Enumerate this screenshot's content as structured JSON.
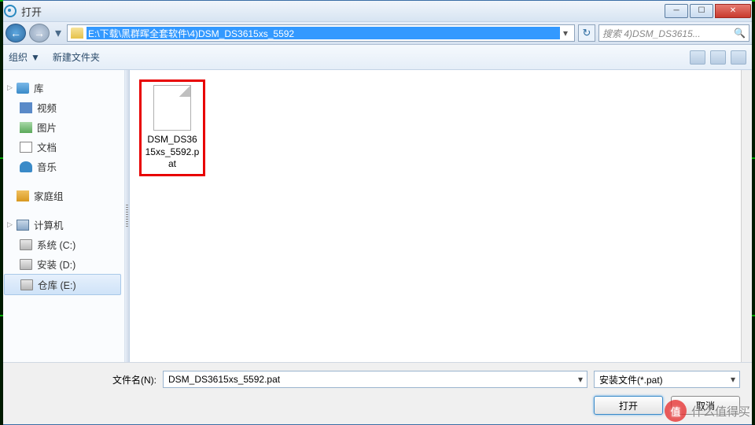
{
  "title": "打开",
  "address_path": "E:\\下载\\黑群晖全套软件\\4)DSM_DS3615xs_5592",
  "search_placeholder": "搜索 4)DSM_DS3615...",
  "toolbar": {
    "organize": "组织",
    "new_folder": "新建文件夹"
  },
  "sidebar": {
    "library": {
      "label": "库",
      "children": [
        {
          "label": "视频"
        },
        {
          "label": "图片"
        },
        {
          "label": "文档"
        },
        {
          "label": "音乐"
        }
      ]
    },
    "homegroup": {
      "label": "家庭组"
    },
    "computer": {
      "label": "计算机",
      "children": [
        {
          "label": "系统 (C:)"
        },
        {
          "label": "安装 (D:)"
        },
        {
          "label": "仓库 (E:)",
          "selected": true
        }
      ]
    }
  },
  "files": [
    {
      "name": "DSM_DS3615xs_5592.pat",
      "highlighted": true
    }
  ],
  "filename_label": "文件名(N):",
  "filename_value": "DSM_DS3615xs_5592.pat",
  "filter_value": "安装文件(*.pat)",
  "open_btn": "打开",
  "cancel_btn": "取消",
  "watermark": "什么值得买"
}
